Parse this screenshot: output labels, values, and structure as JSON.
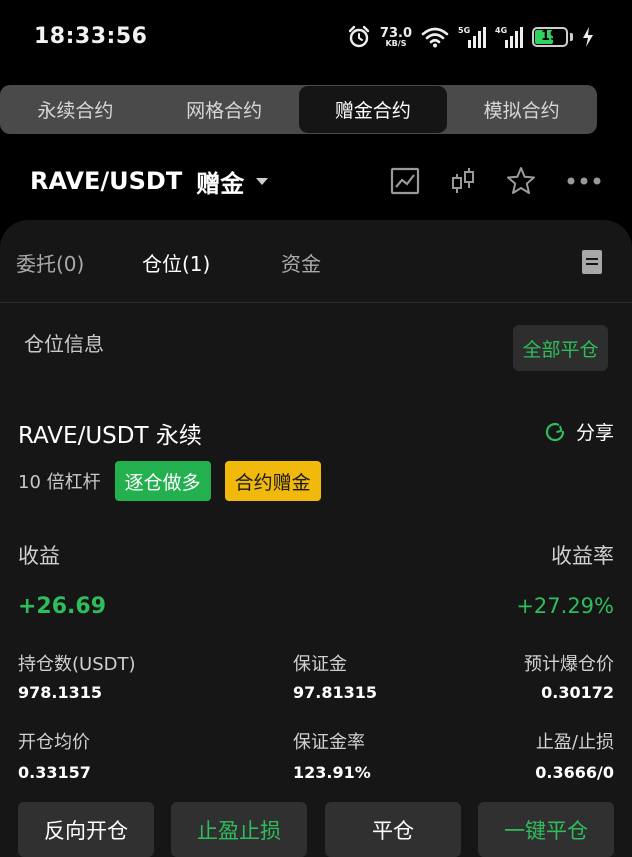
{
  "status_bar": {
    "time": "18:33:56",
    "net_speed": "73.0",
    "net_unit": "KB/S",
    "sim1_label": "5G",
    "sim2_label": "4G",
    "battery": "19",
    "battery_color": "#2fd35d"
  },
  "mode_tabs": [
    {
      "label": "永续合约",
      "active": false
    },
    {
      "label": "网格合约",
      "active": false
    },
    {
      "label": "赠金合约",
      "active": true
    },
    {
      "label": "模拟合约",
      "active": false
    }
  ],
  "header": {
    "pair": "RAVE/USDT",
    "tag": "赠金",
    "icons": [
      "chart-icon",
      "candlestick-icon",
      "star-icon",
      "more-icon"
    ]
  },
  "panel_tabs": [
    {
      "label": "委托(0)",
      "active": false
    },
    {
      "label": "仓位(1)",
      "active": true
    },
    {
      "label": "资金",
      "active": false
    }
  ],
  "position_section": {
    "title": "仓位信息",
    "close_all": "全部平仓"
  },
  "position": {
    "name": "RAVE/USDT 永续",
    "share": "分享",
    "leverage": "10 倍杠杆",
    "badge_direction": "逐仓做多",
    "badge_type": "合约赠金",
    "pnl_label": "收益",
    "pnl_value": "+26.69",
    "roe_label": "收益率",
    "roe_value": "+27.29%",
    "stats": [
      {
        "label": "持仓数(USDT)",
        "value": "978.1315"
      },
      {
        "label": "保证金",
        "value": "97.81315"
      },
      {
        "label": "预计爆仓价",
        "value": "0.30172"
      },
      {
        "label": "开仓均价",
        "value": "0.33157"
      },
      {
        "label": "保证金率",
        "value": "123.91%"
      },
      {
        "label": "止盈/止损",
        "value": "0.3666/0"
      }
    ]
  },
  "actions": [
    {
      "label": "反向开仓",
      "style": "default"
    },
    {
      "label": "止盈止损",
      "style": "green"
    },
    {
      "label": "平仓",
      "style": "default"
    },
    {
      "label": "一键平仓",
      "style": "green"
    }
  ],
  "colors": {
    "accent_green": "#2fbd5c",
    "badge_green": "#23b04f",
    "badge_yellow": "#f0b90b",
    "panel_bg": "#161616"
  }
}
